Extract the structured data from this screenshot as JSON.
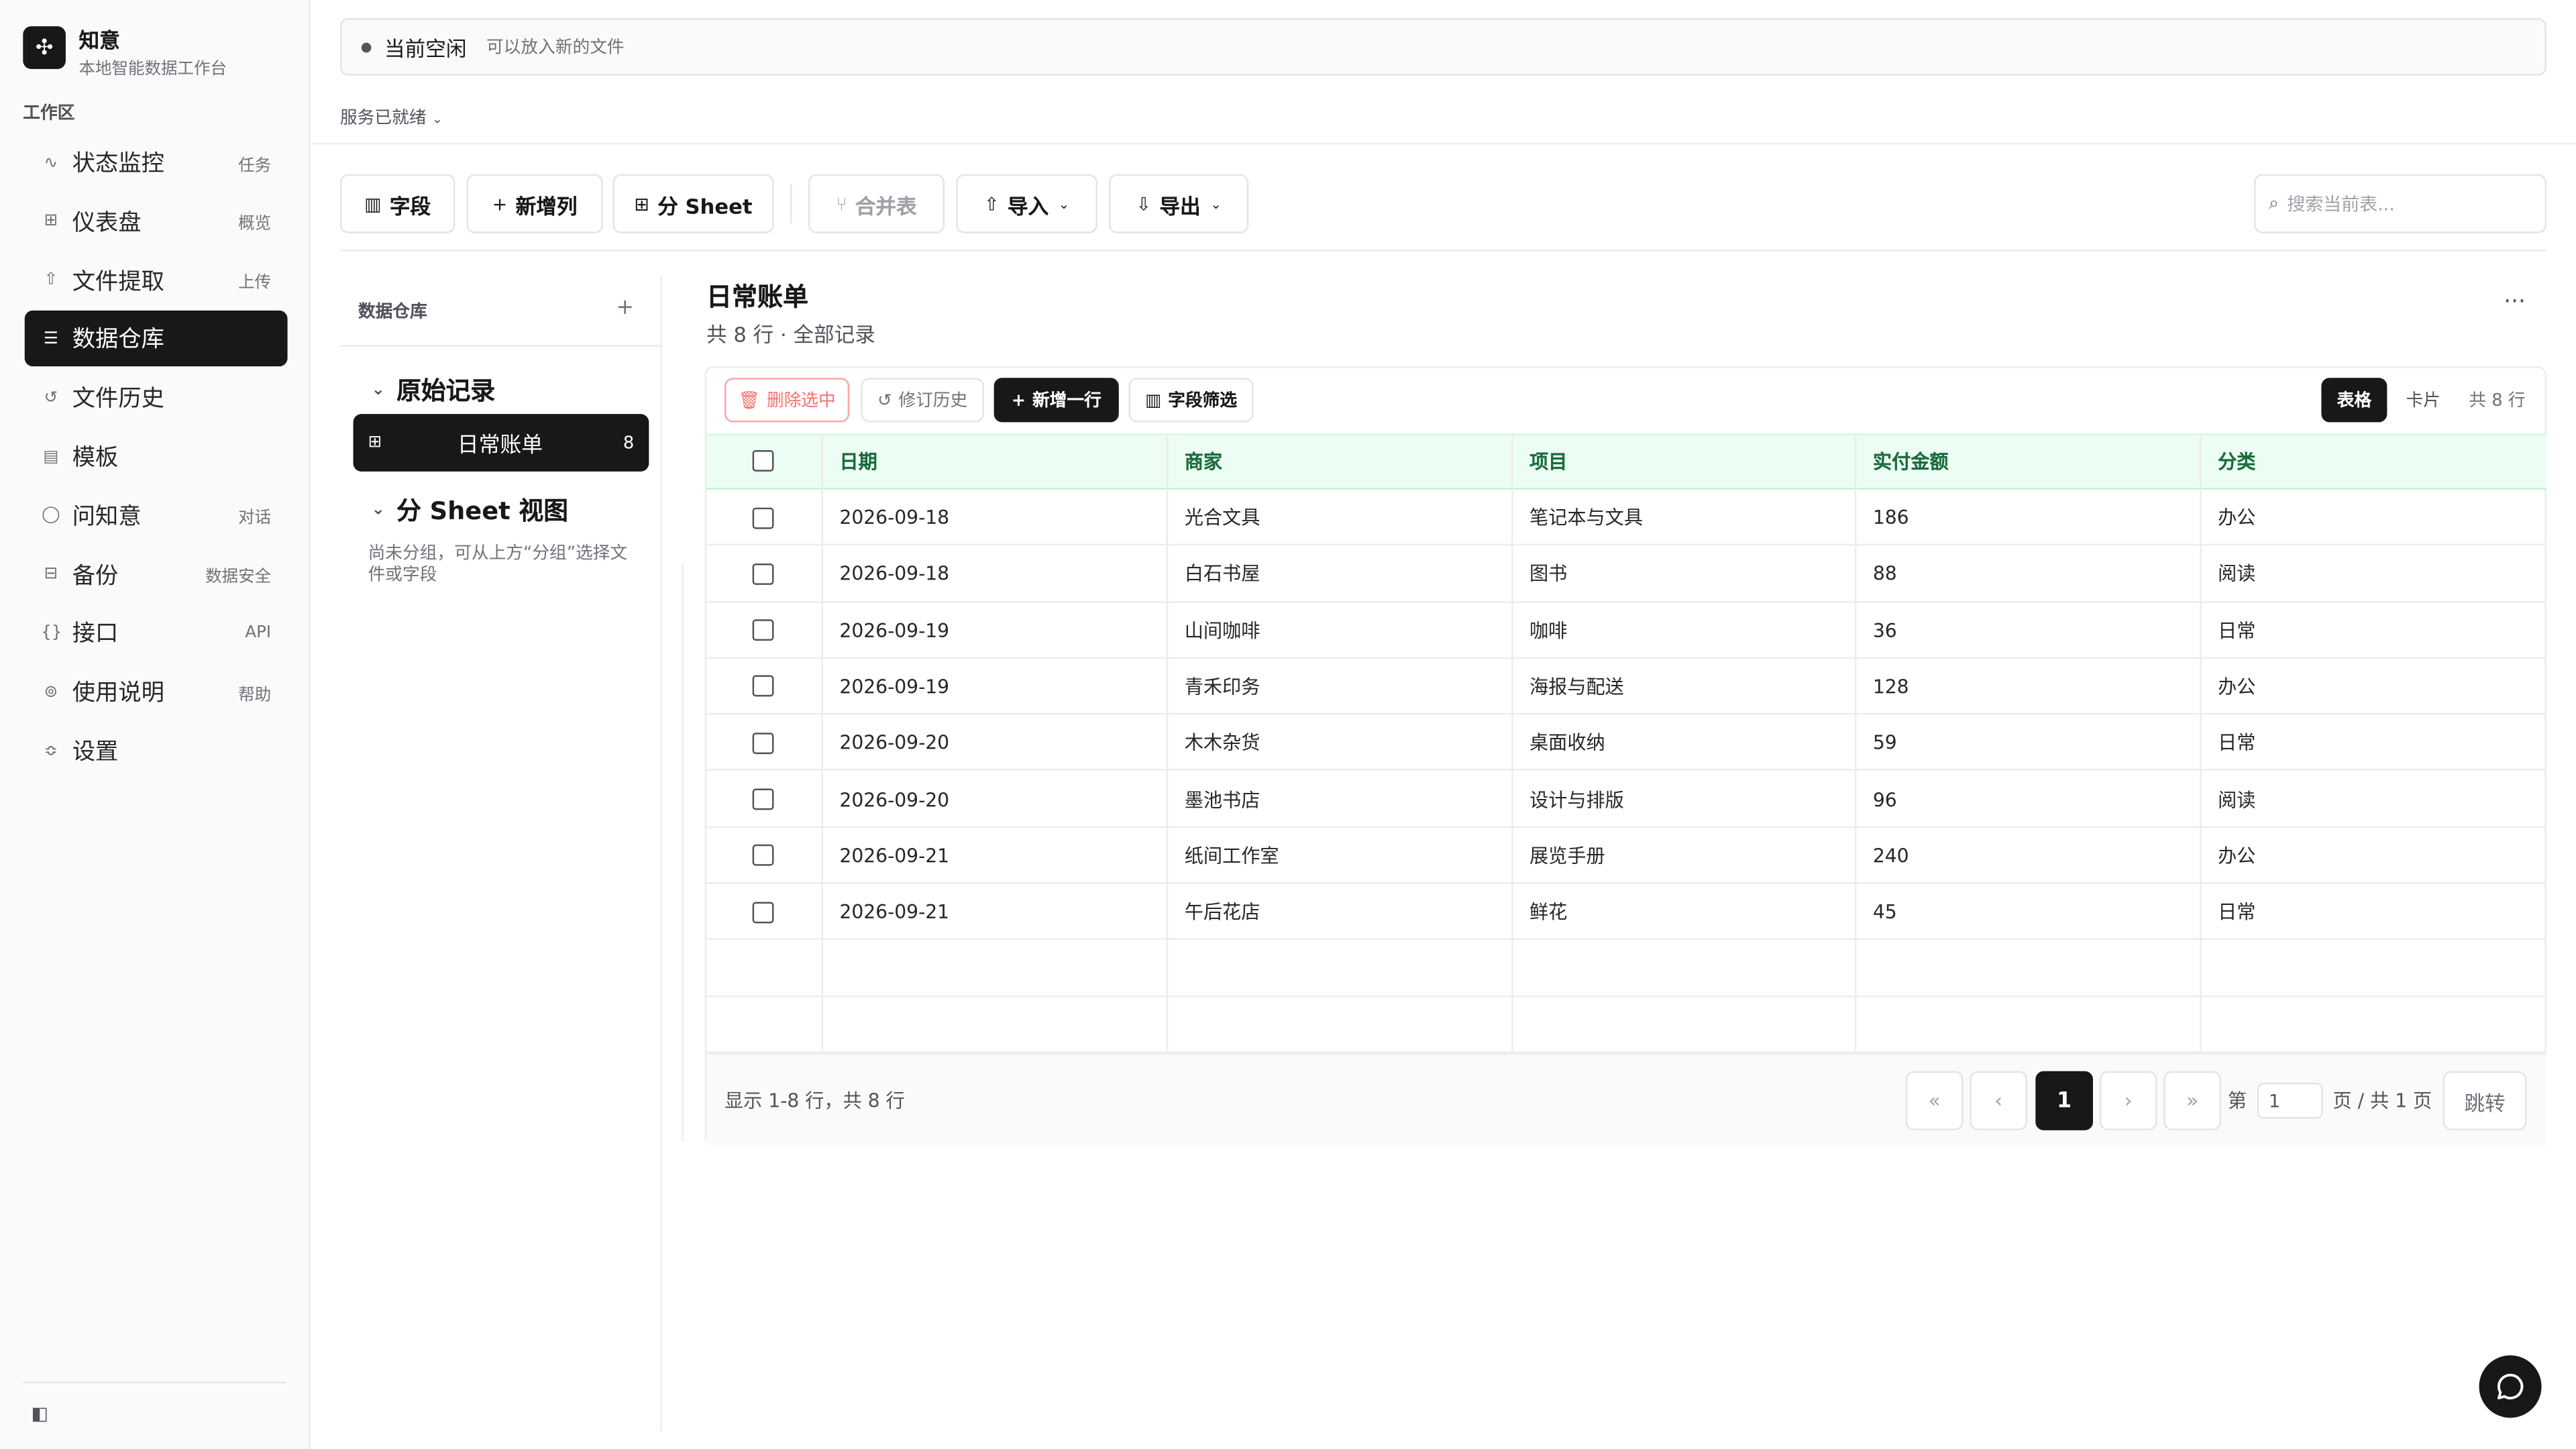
{
  "brand": {
    "name": "知意",
    "subtitle": "本地智能数据工作台"
  },
  "sidebar": {
    "section": "工作区",
    "items": [
      {
        "label": "状态监控",
        "hint": "任务",
        "icon": "activity-icon"
      },
      {
        "label": "仪表盘",
        "hint": "概览",
        "icon": "grid-icon"
      },
      {
        "label": "文件提取",
        "hint": "上传",
        "icon": "upload-icon"
      },
      {
        "label": "数据仓库",
        "hint": "",
        "icon": "database-icon"
      },
      {
        "label": "文件历史",
        "hint": "",
        "icon": "history-icon"
      },
      {
        "label": "模板",
        "hint": "",
        "icon": "file-icon"
      },
      {
        "label": "问知意",
        "hint": "对话",
        "icon": "chat-icon"
      },
      {
        "label": "备份",
        "hint": "数据安全",
        "icon": "backup-icon"
      },
      {
        "label": "接口",
        "hint": "API",
        "icon": "braces-icon"
      },
      {
        "label": "使用说明",
        "hint": "帮助",
        "icon": "help-icon"
      },
      {
        "label": "设置",
        "hint": "",
        "icon": "sliders-icon"
      }
    ]
  },
  "status": {
    "title": "当前空闲",
    "subtitle": "可以放入新的文件",
    "service": "服务已就绪"
  },
  "toolbar": {
    "fields": "字段",
    "add_column": "新增列",
    "split_sheet": "分 Sheet",
    "merge": "合并表",
    "import": "导入",
    "export": "导出",
    "search_placeholder": "搜索当前表..."
  },
  "tree": {
    "header": "数据仓库",
    "group1": "原始记录",
    "item": "日常账单",
    "item_count": "8",
    "group2": "分 Sheet 视图",
    "empty_note": "尚未分组，可从上方“分组”选择文件或字段"
  },
  "table": {
    "title": "日常账单",
    "subtitle": "共 8 行 · 全部记录",
    "actions": {
      "delete": "删除选中",
      "history": "修订历史",
      "add_row": "新增一行",
      "filter": "字段筛选"
    },
    "views": {
      "table": "表格",
      "card": "卡片",
      "count": "共 8 行"
    },
    "columns": [
      "日期",
      "商家",
      "项目",
      "实付金额",
      "分类"
    ],
    "rows": [
      [
        "2026-09-18",
        "光合文具",
        "笔记本与文具",
        "186",
        "办公"
      ],
      [
        "2026-09-18",
        "白石书屋",
        "图书",
        "88",
        "阅读"
      ],
      [
        "2026-09-19",
        "山间咖啡",
        "咖啡",
        "36",
        "日常"
      ],
      [
        "2026-09-19",
        "青禾印务",
        "海报与配送",
        "128",
        "办公"
      ],
      [
        "2026-09-20",
        "木木杂货",
        "桌面收纳",
        "59",
        "日常"
      ],
      [
        "2026-09-20",
        "墨池书店",
        "设计与排版",
        "96",
        "阅读"
      ],
      [
        "2026-09-21",
        "纸间工作室",
        "展览手册",
        "240",
        "办公"
      ],
      [
        "2026-09-21",
        "午后花店",
        "鲜花",
        "45",
        "日常"
      ]
    ]
  },
  "pagination": {
    "summary": "显示 1-8 行，共 8 行",
    "first": "«",
    "prev": "‹",
    "current": "1",
    "next": "›",
    "last": "»",
    "page_prefix": "第",
    "page_value": "1",
    "page_suffix": "页 / 共 1 页",
    "jump": "跳转"
  },
  "colors": {
    "accent": "#18181b",
    "header_bg": "#ecfdf3",
    "header_text": "#1a6b3c",
    "danger": "#f87171"
  }
}
